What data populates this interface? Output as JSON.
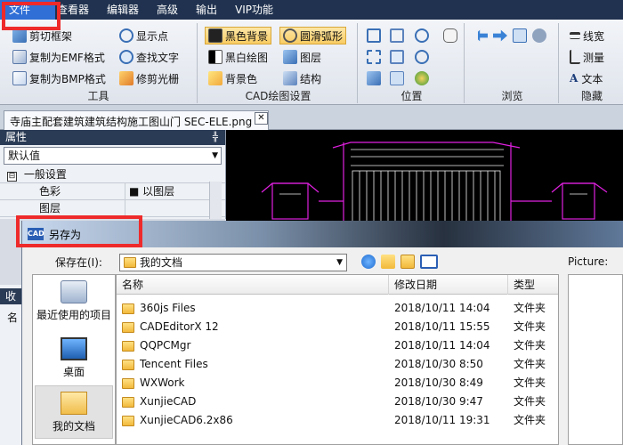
{
  "menu": {
    "items": [
      "文件",
      "查看器",
      "编辑器",
      "高级",
      "输出",
      "VIP功能"
    ]
  },
  "ribbon": {
    "tools": {
      "title": "工具",
      "buttons": [
        "剪切框架",
        "显示点",
        "复制为EMF格式",
        "查找文字",
        "复制为BMP格式",
        "修剪光栅"
      ]
    },
    "cad_settings": {
      "title": "CAD绘图设置",
      "buttons": [
        "黑色背景",
        "圆滑弧形",
        "黑白绘图",
        "图层",
        "背景色",
        "结构"
      ]
    },
    "position": {
      "title": "位置"
    },
    "browse": {
      "title": "浏览"
    },
    "hide": {
      "title": "隐藏",
      "buttons": [
        "线宽",
        "测量",
        "文本"
      ]
    }
  },
  "document_tab": {
    "label": "寺庙主配套建筑建筑结构施工图山门 SEC-ELE.png",
    "close": "✕"
  },
  "properties": {
    "title": "属性",
    "pin": "╬",
    "combo_value": "默认值",
    "section": "一般设置",
    "expander": "⊟",
    "rows": [
      {
        "name": "色彩",
        "value": "■ 以图层"
      },
      {
        "name": "图层",
        "value": ""
      }
    ]
  },
  "background_panel": {
    "tab_label": "收",
    "row_label": "名"
  },
  "dialog": {
    "badge": "CAD",
    "title": "另存为",
    "save_in_label": "保存在(I):",
    "current_folder": "我的文档",
    "picture_label": "Picture:",
    "places": [
      "最近使用的项目",
      "桌面",
      "我的文档"
    ],
    "columns": [
      "名称",
      "修改日期",
      "类型"
    ],
    "files": [
      {
        "name": "360js Files",
        "date": "2018/10/11 14:04",
        "type": "文件夹"
      },
      {
        "name": "CADEditorX 12",
        "date": "2018/10/11 15:55",
        "type": "文件夹"
      },
      {
        "name": "QQPCMgr",
        "date": "2018/10/11 14:04",
        "type": "文件夹"
      },
      {
        "name": "Tencent Files",
        "date": "2018/10/30 8:50",
        "type": "文件夹"
      },
      {
        "name": "WXWork",
        "date": "2018/10/30 8:49",
        "type": "文件夹"
      },
      {
        "name": "XunjieCAD",
        "date": "2018/10/30 9:47",
        "type": "文件夹"
      },
      {
        "name": "XunjieCAD6.2x86",
        "date": "2018/10/11 19:31",
        "type": "文件夹"
      }
    ]
  },
  "colors": {
    "menu_bg": "#20324f",
    "menu_active": "#2f6fd6",
    "highlight": "#ee2a2a",
    "drawing_magenta": "#e020e0",
    "drawing_white": "#f0f0f0"
  }
}
